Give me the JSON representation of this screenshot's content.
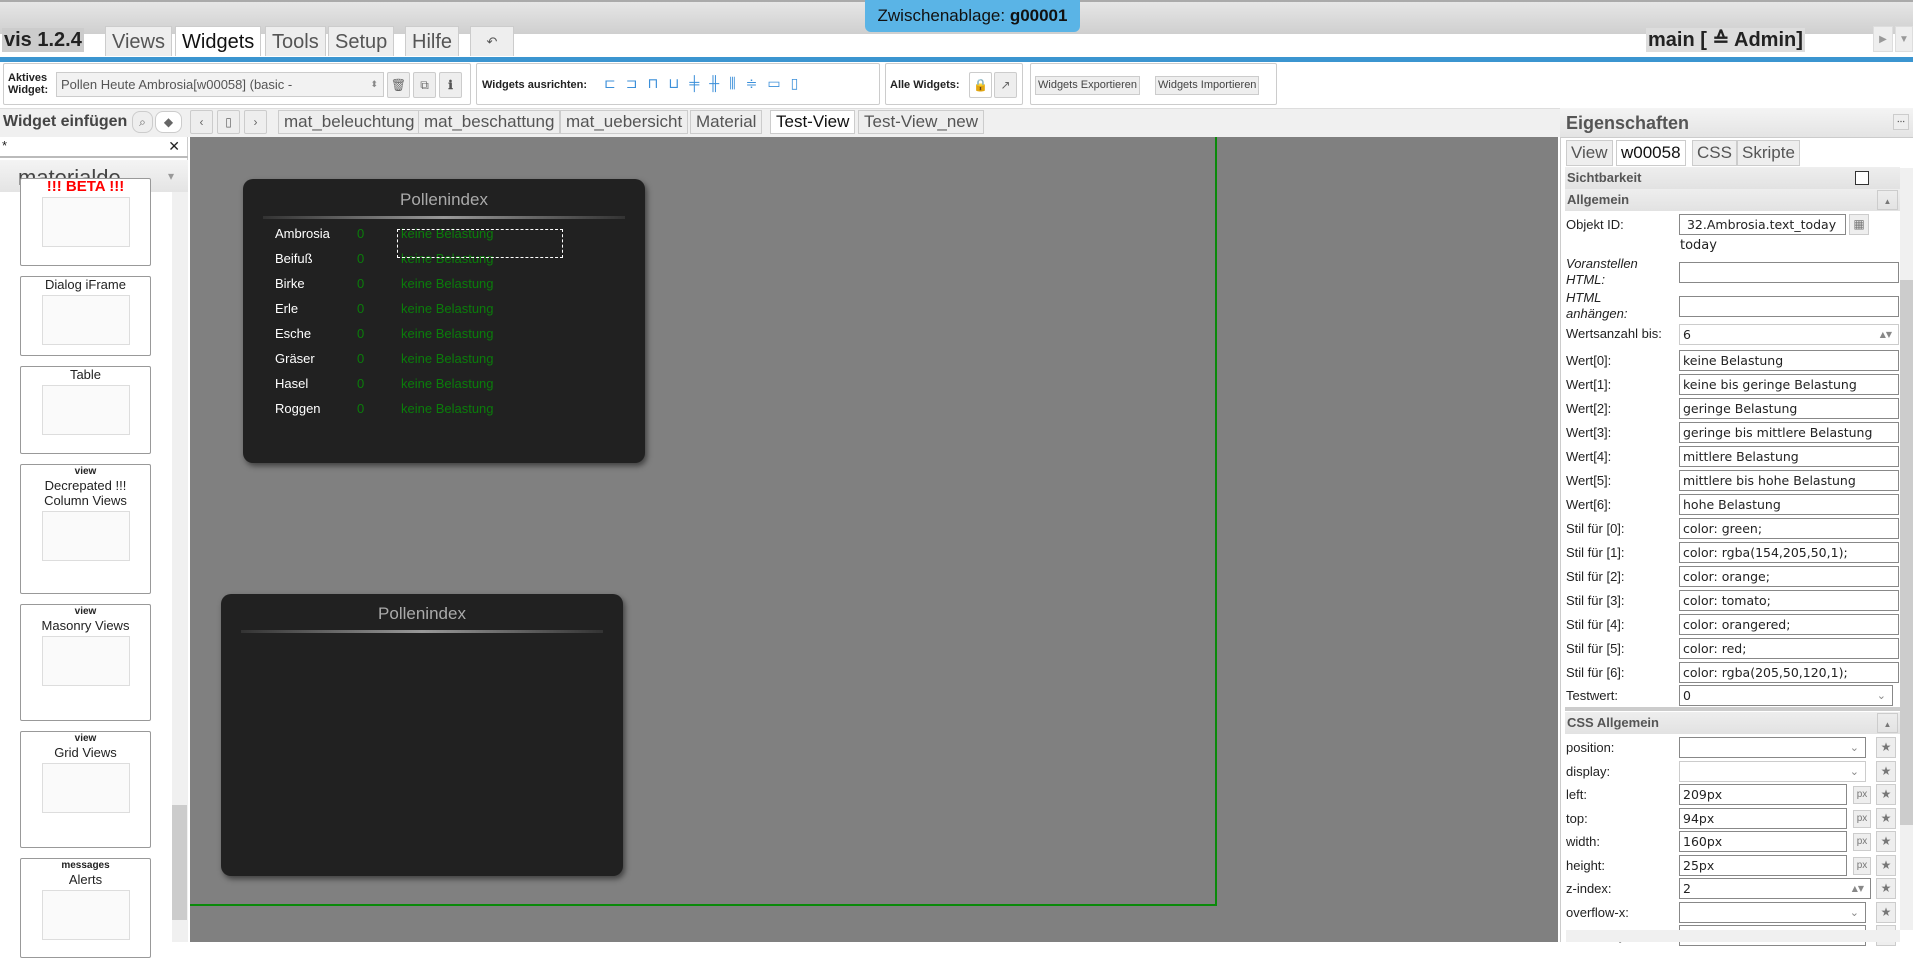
{
  "clipboard": {
    "label": "Zwischenablage:",
    "value": "g00001"
  },
  "app": {
    "version": "vis 1.2.4",
    "user": "main [ ≙ Admin]"
  },
  "menu": [
    "Views",
    "Widgets",
    "Tools",
    "Setup",
    "Hilfe"
  ],
  "toolbar": {
    "active_widget_label": "Aktives Widget:",
    "active_widget_value": "Pollen Heute Ambrosia[w00058] (basic -",
    "align_label": "Widgets ausrichten:",
    "all_widgets_label": "Alle Widgets:",
    "export_label": "Widgets Exportieren",
    "import_label": "Widgets Importieren"
  },
  "insert": {
    "title": "Widget einfügen",
    "search_value": "*",
    "library": "materialde..."
  },
  "view_tabs": [
    "mat_beleuchtung",
    "mat_beschattung",
    "mat_uebersicht",
    "Material",
    "Test-View",
    "Test-View_new"
  ],
  "active_view": "Test-View",
  "palette": [
    {
      "kind": "",
      "title": "!!! BETA !!!"
    },
    {
      "kind": "",
      "title": "Dialog iFrame"
    },
    {
      "kind": "",
      "title": "Table"
    },
    {
      "kind": "view",
      "title": "Decrepated !!! Column Views"
    },
    {
      "kind": "view",
      "title": "Masonry Views"
    },
    {
      "kind": "view",
      "title": "Grid Views"
    },
    {
      "kind": "messages",
      "title": "Alerts"
    }
  ],
  "pollen_widget": {
    "title": "Pollenindex",
    "rows": [
      {
        "name": "Ambrosia",
        "value": "0",
        "text": "keine Belastung"
      },
      {
        "name": "Beifuß",
        "value": "0",
        "text": "keine Belastung"
      },
      {
        "name": "Birke",
        "value": "0",
        "text": "keine Belastung"
      },
      {
        "name": "Erle",
        "value": "0",
        "text": "keine Belastung"
      },
      {
        "name": "Esche",
        "value": "0",
        "text": "keine Belastung"
      },
      {
        "name": "Gräser",
        "value": "0",
        "text": "keine Belastung"
      },
      {
        "name": "Hasel",
        "value": "0",
        "text": "keine Belastung"
      },
      {
        "name": "Roggen",
        "value": "0",
        "text": "keine Belastung"
      }
    ]
  },
  "pollen_widget_2": {
    "title": "Pollenindex"
  },
  "properties": {
    "title": "Eigenschaften",
    "tabs": [
      "View",
      "w00058",
      "CSS",
      "Skripte"
    ],
    "sichtbarkeit": "Sichtbarkeit",
    "allgemein": "Allgemein",
    "object_id_label": "Objekt ID:",
    "object_id_value": " 32.Ambrosia.text_today",
    "object_id_hint": "today",
    "prepend_label": "Voranstellen HTML:",
    "append_label": "HTML anhängen:",
    "count_label": "Wertsanzahl bis:",
    "count_value": "6",
    "fields": [
      {
        "label": "Wert[0]:",
        "value": "keine Belastung"
      },
      {
        "label": "Wert[1]:",
        "value": "keine bis geringe Belastung"
      },
      {
        "label": "Wert[2]:",
        "value": "geringe Belastung"
      },
      {
        "label": "Wert[3]:",
        "value": "geringe bis mittlere Belastung"
      },
      {
        "label": "Wert[4]:",
        "value": "mittlere Belastung"
      },
      {
        "label": "Wert[5]:",
        "value": "mittlere bis hohe Belastung"
      },
      {
        "label": "Wert[6]:",
        "value": "hohe Belastung"
      },
      {
        "label": "Stil für [0]:",
        "value": "color: green;"
      },
      {
        "label": "Stil für [1]:",
        "value": "color: rgba(154,205,50,1);"
      },
      {
        "label": "Stil für [2]:",
        "value": "color: orange;"
      },
      {
        "label": "Stil für [3]:",
        "value": "color: tomato;"
      },
      {
        "label": "Stil für [4]:",
        "value": "color: orangered;"
      },
      {
        "label": "Stil für [5]:",
        "value": "color: red;"
      },
      {
        "label": "Stil für [6]:",
        "value": "color: rgba(205,50,120,1);"
      }
    ],
    "test_label": "Testwert:",
    "test_value": "0",
    "css_section": "CSS Allgemein",
    "css": [
      {
        "label": "position:",
        "value": "",
        "type": "select"
      },
      {
        "label": "display:",
        "value": "",
        "type": "select"
      },
      {
        "label": "left:",
        "value": "209px",
        "type": "px"
      },
      {
        "label": "top:",
        "value": "94px",
        "type": "px"
      },
      {
        "label": "width:",
        "value": "160px",
        "type": "px"
      },
      {
        "label": "height:",
        "value": "25px",
        "type": "px"
      },
      {
        "label": "z-index:",
        "value": "2",
        "type": "spin"
      },
      {
        "label": "overflow-x:",
        "value": "",
        "type": "select"
      },
      {
        "label": "overflow-y:",
        "value": "",
        "type": "select"
      }
    ],
    "px_unit": "px"
  },
  "colors": {
    "accent": "#3b95d0",
    "clipboard": "#5ab4e6",
    "value_green": "#0a7d0a",
    "canvas": "#808080",
    "widget_bg": "#212121"
  }
}
